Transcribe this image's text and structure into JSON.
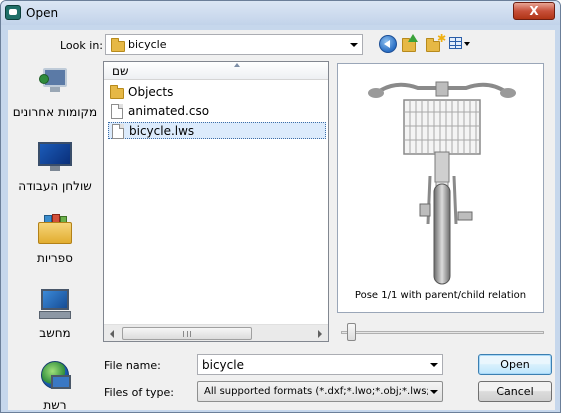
{
  "window": {
    "title": "Open",
    "close_glyph": "X"
  },
  "toolbar": {
    "look_in_label": "Look in:",
    "look_in_value": "bicycle"
  },
  "places": [
    {
      "label": "מקומות אחרונים",
      "icon": "recent-places-icon"
    },
    {
      "label": "שולחן העבודה",
      "icon": "desktop-icon"
    },
    {
      "label": "ספריות",
      "icon": "libraries-icon"
    },
    {
      "label": "מחשב",
      "icon": "computer-icon"
    },
    {
      "label": "רשת",
      "icon": "network-icon"
    }
  ],
  "file_list": {
    "column_header": "שם",
    "items": [
      {
        "name": "Objects",
        "type": "folder"
      },
      {
        "name": "animated.cso",
        "type": "file"
      },
      {
        "name": "bicycle.lws",
        "type": "file",
        "selected": true
      }
    ]
  },
  "preview": {
    "caption": "Pose 1/1 with parent/child relation",
    "slider_fraction": 0.0
  },
  "form": {
    "file_name_label": "File name:",
    "file_name_value": "bicycle",
    "file_type_label": "Files of type:",
    "file_type_value": "All supported formats (*.dxf;*.lwo;*.obj;*.lws;*.cso)"
  },
  "buttons": {
    "open": "Open",
    "cancel": "Cancel"
  },
  "colors": {
    "window_frame": "#c6d7ec",
    "close_button": "#c7503a",
    "selection": "#dcebfc"
  }
}
